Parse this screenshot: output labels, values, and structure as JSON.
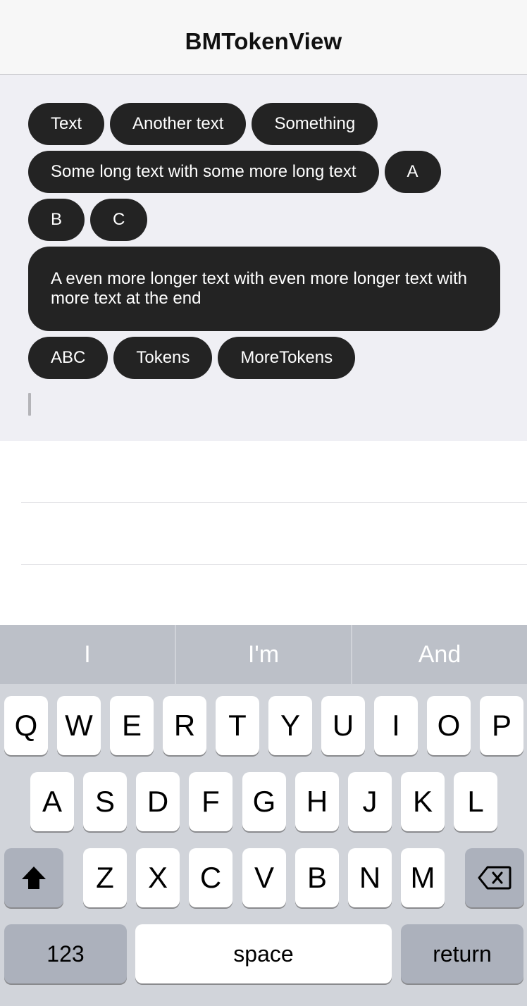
{
  "nav": {
    "title": "BMTokenView"
  },
  "tokens": [
    "Text",
    "Another text",
    "Something",
    "Some long text with some more long text",
    "A",
    "B",
    "C",
    "A even more longer text with even more longer text with more text at the end",
    "ABC",
    "Tokens",
    "MoreTokens"
  ],
  "keyboard": {
    "suggestions": [
      "I",
      "I'm",
      "And"
    ],
    "row1": [
      "Q",
      "W",
      "E",
      "R",
      "T",
      "Y",
      "U",
      "I",
      "O",
      "P"
    ],
    "row2": [
      "A",
      "S",
      "D",
      "F",
      "G",
      "H",
      "J",
      "K",
      "L"
    ],
    "row3": [
      "Z",
      "X",
      "C",
      "V",
      "B",
      "N",
      "M"
    ],
    "numbers_label": "123",
    "space_label": "space",
    "return_label": "return",
    "shift_icon": "shift-arrow-icon",
    "delete_icon": "backspace-icon"
  }
}
